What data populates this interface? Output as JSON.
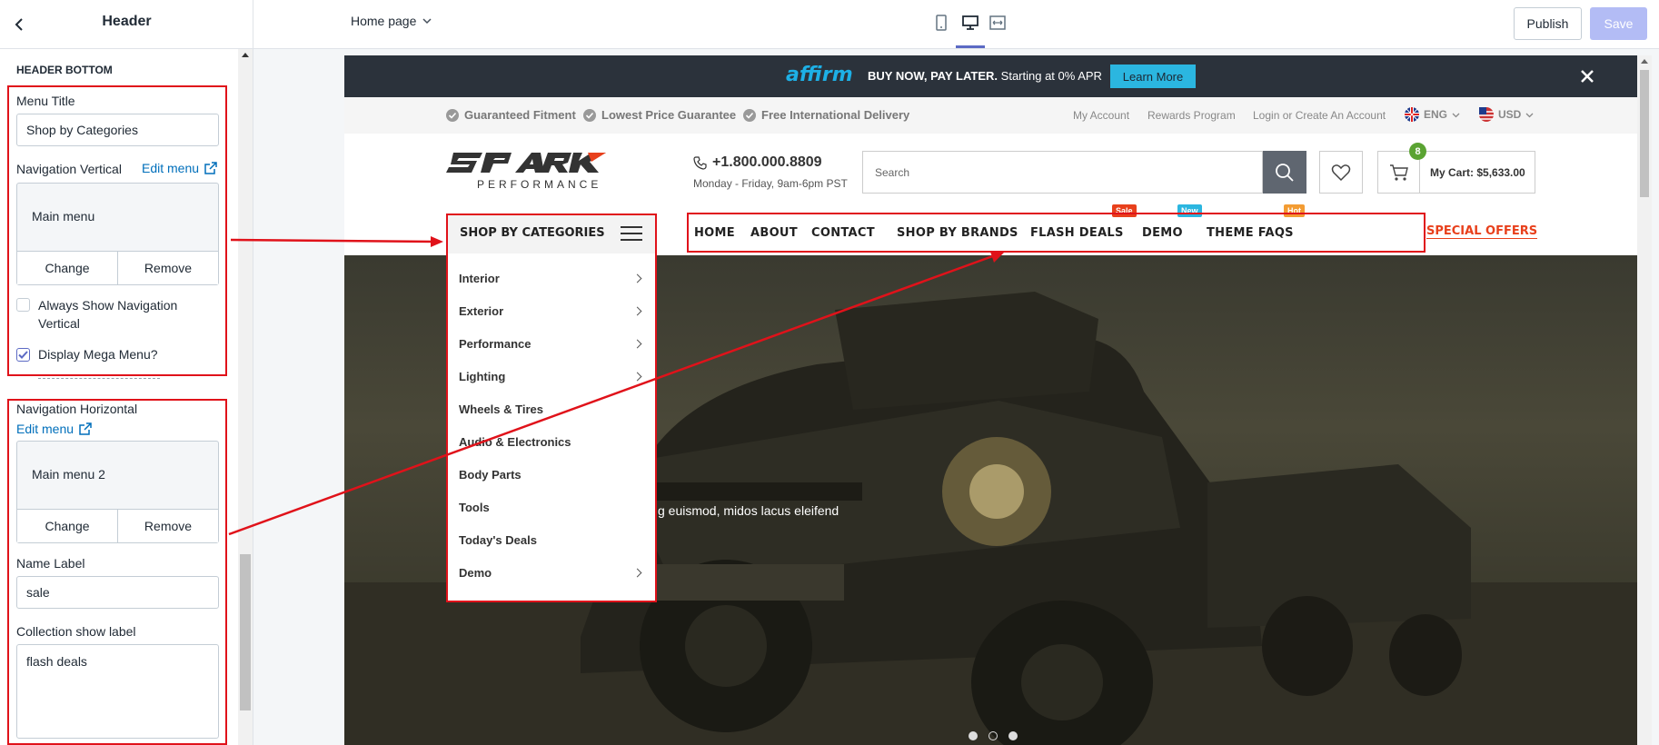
{
  "editor": {
    "section_title": "Header",
    "page_select": "Home page",
    "publish_label": "Publish",
    "save_label": "Save"
  },
  "sidebar": {
    "group_title": "HEADER BOTTOM",
    "menu_title_label": "Menu Title",
    "menu_title_value": "Shop by Categories",
    "nav_vertical_label": "Navigation Vertical",
    "edit_menu_label": "Edit menu",
    "vertical_menu_name": "Main menu",
    "change_label": "Change",
    "remove_label": "Remove",
    "always_show_label": "Always Show Navigation Vertical",
    "always_show_checked": false,
    "display_mega_label": "Display Mega Menu?",
    "display_mega_checked": true,
    "nav_horizontal_label": "Navigation Horizontal",
    "horizontal_menu_name": "Main menu 2",
    "name_label_label": "Name Label",
    "name_label_value": "sale",
    "collection_label_label": "Collection show label",
    "collection_label_value": "flash deals"
  },
  "store": {
    "promo": {
      "brand": "affirm",
      "text_bold": "BUY NOW, PAY LATER.",
      "text": "Starting at 0% APR",
      "button": "Learn More",
      "bg": "#2b323b",
      "button_color": "#2bb6e0"
    },
    "features": [
      "Guaranteed Fitment",
      "Lowest Price Guarantee",
      "Free International Delivery"
    ],
    "top_links": [
      "My Account",
      "Rewards Program",
      "Login or Create An Account"
    ],
    "language": "ENG",
    "currency": "USD",
    "logo_sub": "PERFORMANCE",
    "phone": "+1.800.000.8809",
    "hours": "Monday - Friday, 9am-6pm PST",
    "search_placeholder": "Search",
    "cart_count": "8",
    "cart_label": "My Cart: $5,633.00",
    "categories_title": "SHOP BY CATEGORIES",
    "categories": [
      {
        "label": "Interior",
        "arrow": true
      },
      {
        "label": "Exterior",
        "arrow": true
      },
      {
        "label": "Performance",
        "arrow": true
      },
      {
        "label": "Lighting",
        "arrow": true
      },
      {
        "label": "Wheels & Tires",
        "arrow": false
      },
      {
        "label": "Audio & Electronics",
        "arrow": false
      },
      {
        "label": "Body Parts",
        "arrow": false
      },
      {
        "label": "Tools",
        "arrow": false
      },
      {
        "label": "Today's Deals",
        "arrow": false
      },
      {
        "label": "Demo",
        "arrow": true
      }
    ],
    "nav": [
      "HOME",
      "ABOUT",
      "CONTACT",
      "SHOP BY BRANDS",
      "FLASH DEALS",
      "DEMO",
      "THEME FAQS"
    ],
    "badges": {
      "sale": "Sale",
      "new": "New",
      "hot": "Hot"
    },
    "special_offers": "SPECIAL OFFERS",
    "hero_text": "g euismod, midos lacus eleifend",
    "accent": "#e8401c"
  }
}
